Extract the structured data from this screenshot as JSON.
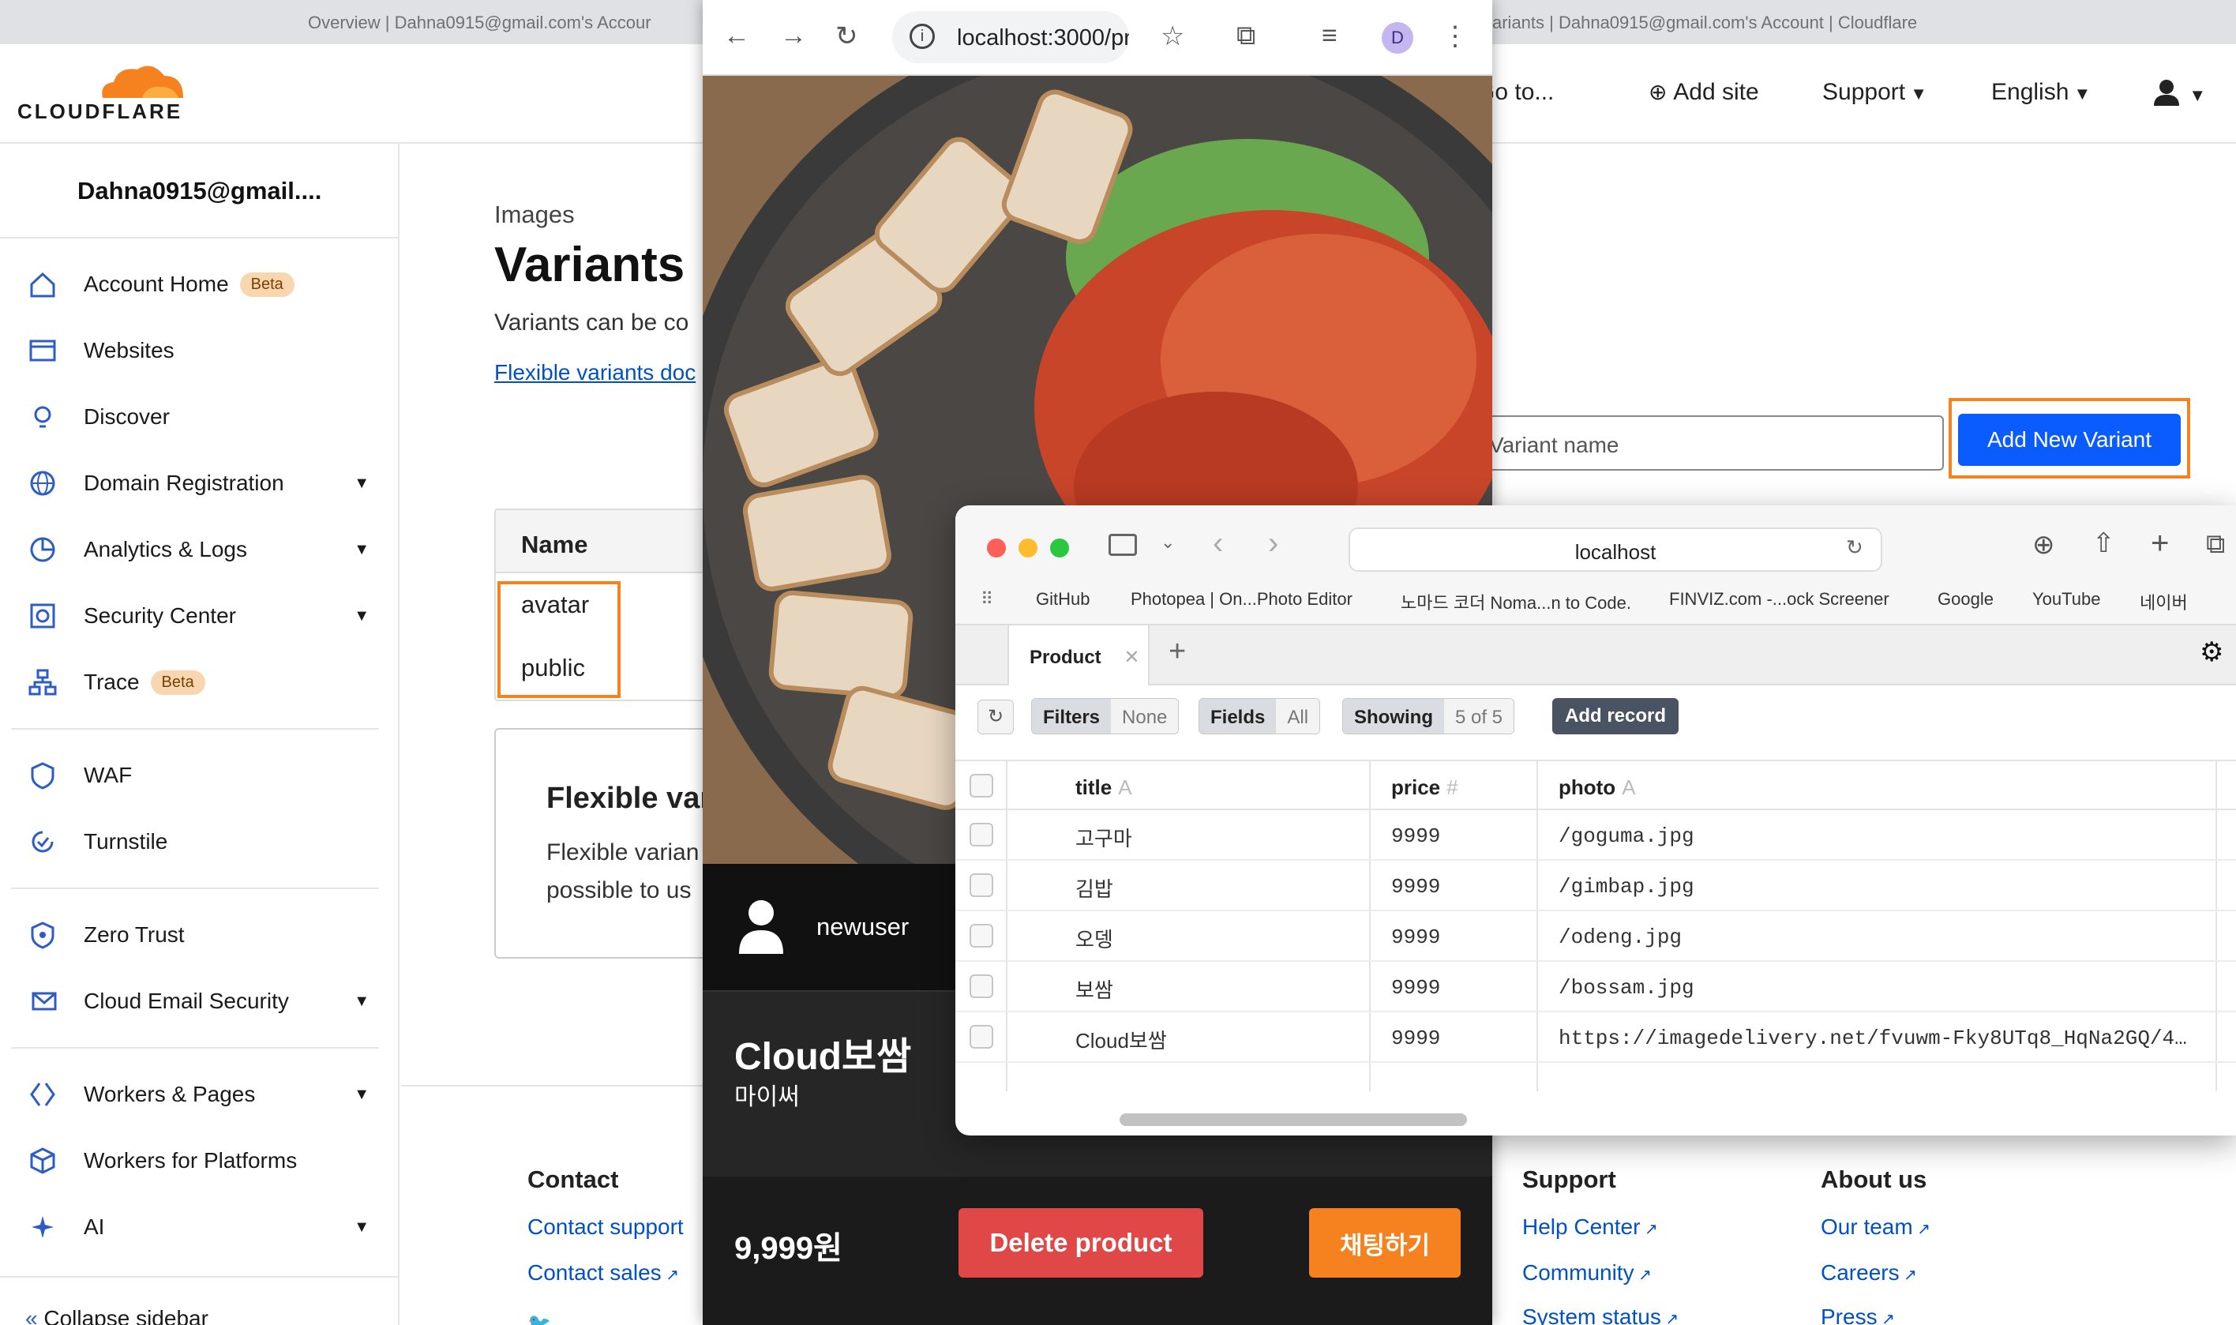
{
  "browser_tabs": {
    "left": "Overview | Dahna0915@gmail.com's Accour",
    "right": "ariants | Dahna0915@gmail.com's Account | Cloudflare"
  },
  "cloudflare": {
    "logo": "CLOUDFLARE",
    "nav": {
      "goto": "Go to...",
      "add_site": "Add site",
      "support": "Support",
      "language": "English"
    },
    "account_name": "Dahna0915@gmail....",
    "sidebar": [
      {
        "label": "Account Home",
        "badge": "Beta",
        "icon": "home-icon"
      },
      {
        "label": "Websites",
        "icon": "browser-icon"
      },
      {
        "label": "Discover",
        "icon": "lightbulb-icon"
      },
      {
        "label": "Domain Registration",
        "icon": "globe-icon"
      },
      {
        "label": "Analytics & Logs",
        "icon": "chart-icon"
      },
      {
        "label": "Security Center",
        "icon": "shield-icon"
      },
      {
        "label": "Trace",
        "badge": "Beta",
        "icon": "trace-icon"
      },
      {
        "label": "WAF",
        "icon": "waf-icon"
      },
      {
        "label": "Turnstile",
        "icon": "turnstile-icon"
      },
      {
        "label": "Zero Trust",
        "icon": "zerotrust-icon"
      },
      {
        "label": "Cloud Email Security",
        "icon": "email-icon"
      },
      {
        "label": "Workers & Pages",
        "icon": "workers-icon"
      },
      {
        "label": "Workers for Platforms",
        "icon": "cube-icon"
      },
      {
        "label": "AI",
        "icon": "ai-icon"
      }
    ],
    "collapse": "Collapse sidebar",
    "main": {
      "crumb": "Images",
      "title": "Variants",
      "desc": "Variants can be co",
      "link": "Flexible variants doc",
      "table_header": "Name",
      "rows": [
        "avatar",
        "public"
      ],
      "flex_title": "Flexible var",
      "flex_line1": "Flexible varian",
      "flex_line2": "possible to us",
      "variant_placeholder": "Variant name",
      "add_variant": "Add New Variant"
    },
    "footer": {
      "contact": {
        "title": "Contact",
        "links": [
          "Contact support",
          "Contact sales"
        ]
      },
      "support": {
        "title": "Support",
        "links": [
          "Help Center",
          "Community",
          "System status"
        ]
      },
      "about": {
        "title": "About us",
        "links": [
          "Our team",
          "Careers",
          "Press"
        ]
      }
    }
  },
  "chrome_popup": {
    "url": "localhost:3000/pr...",
    "profile_initial": "D",
    "username": "newuser",
    "product_name": "Cloud보쌈",
    "product_sub": "마이써",
    "price": "9,999원",
    "delete_button": "Delete product",
    "chat_button": "채팅하기"
  },
  "safari": {
    "url": "localhost",
    "bookmarks": [
      "GitHub",
      "Photopea | On...Photo Editor",
      "노마드 코더 Noma...n to Code.",
      "FINVIZ.com -...ock Screener",
      "Google",
      "YouTube",
      "네이버"
    ],
    "tab": "Product",
    "toolbar": {
      "filters": "Filters",
      "filters_val": "None",
      "fields": "Fields",
      "fields_val": "All",
      "showing": "Showing",
      "showing_val": "5 of 5",
      "add_record": "Add record"
    },
    "columns": [
      {
        "name": "title",
        "type": "A"
      },
      {
        "name": "price",
        "type": "#"
      },
      {
        "name": "photo",
        "type": "A"
      }
    ],
    "rows": [
      {
        "title": "고구마",
        "price": "9999",
        "photo": "/goguma.jpg"
      },
      {
        "title": "김밥",
        "price": "9999",
        "photo": "/gimbap.jpg"
      },
      {
        "title": "오뎅",
        "price": "9999",
        "photo": "/odeng.jpg"
      },
      {
        "title": "보쌈",
        "price": "9999",
        "photo": "/bossam.jpg"
      },
      {
        "title": "Cloud보쌈",
        "price": "9999",
        "photo": "https://imagedelivery.net/fvuwm-Fky8UTq8_HqNa2GQ/4…"
      }
    ]
  },
  "colors": {
    "cf_orange": "#f6821f",
    "cf_blue": "#0a5cff",
    "delete_red": "#e04848"
  }
}
